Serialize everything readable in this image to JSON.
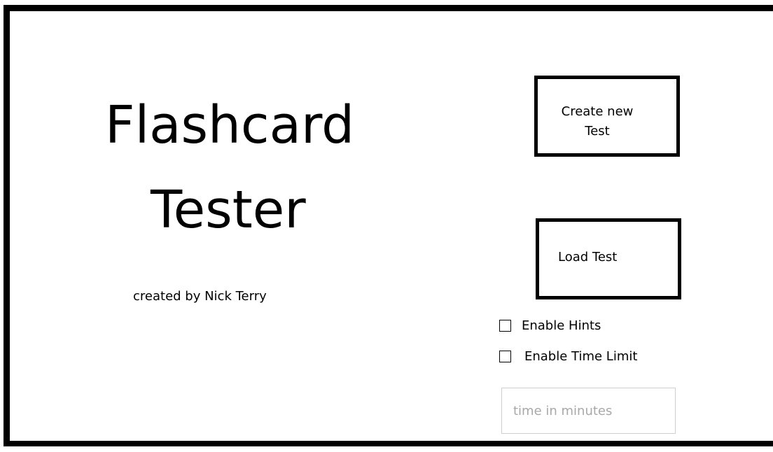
{
  "app": {
    "title_line_1": "Flashcard",
    "title_line_2": "Tester",
    "byline": "created by Nick Terry"
  },
  "buttons": {
    "create_label": "Create new Test",
    "load_label": "Load Test"
  },
  "options": [
    {
      "label": "Enable Hints",
      "checked": false
    },
    {
      "label": "Enable Time Limit",
      "checked": false
    }
  ],
  "time_input": {
    "placeholder": "time in minutes",
    "value": ""
  }
}
